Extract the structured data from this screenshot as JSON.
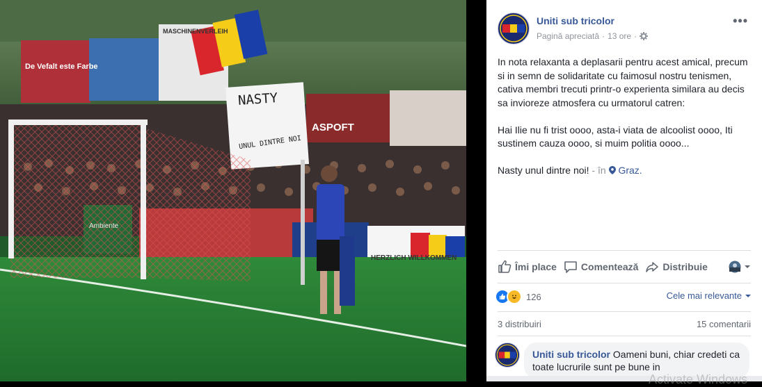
{
  "post": {
    "page_name": "Uniti sub tricolor",
    "meta_label": "Pagină apreciată",
    "time": "13 ore",
    "separator": "·",
    "more": "•••",
    "avatar_text": "UNITI SUB TRICOLOR",
    "paragraphs": [
      "In nota relaxanta a deplasarii pentru acest amical, precum si in semn de solidaritate cu faimosul nostru tenismen, cativa membri trecuti printr-o experienta similara au decis sa invioreze atmosfera cu urmatorul catren:",
      "Hai Ilie nu fi trist oooo, asta-i viata de alcoolist oooo, Iti sustinem cauza oooo, si muim politia oooo...",
      "Nasty unul dintre noi!"
    ],
    "location_prefix": "- în",
    "location": "Graz."
  },
  "photo": {
    "banners": [
      "De Vefalt este Farbe",
      "MASCHINENVERLEIH",
      "ASPOFT",
      "NASTY",
      "UNUL DINTRE NOI",
      "HERZLICH WILLKOMMEN",
      "Ambiente"
    ]
  },
  "actions": {
    "like": "Îmi place",
    "comment": "Comentează",
    "share": "Distribuie"
  },
  "reactions": {
    "count": "126",
    "sort_label": "Cele mai relevante"
  },
  "stats": {
    "shares": "3 distribuiri",
    "comments": "15 comentarii"
  },
  "comment": {
    "author": "Uniti sub tricolor",
    "text": "Oameni buni, chiar credeti ca toate lucrurile sunt pe bune in"
  },
  "watermark": "Activate Windows",
  "colors": {
    "link": "#385898",
    "muted": "#90949c",
    "text": "#1d2129",
    "like_blue": "#1877f2",
    "haha_yellow": "#f7b928"
  }
}
